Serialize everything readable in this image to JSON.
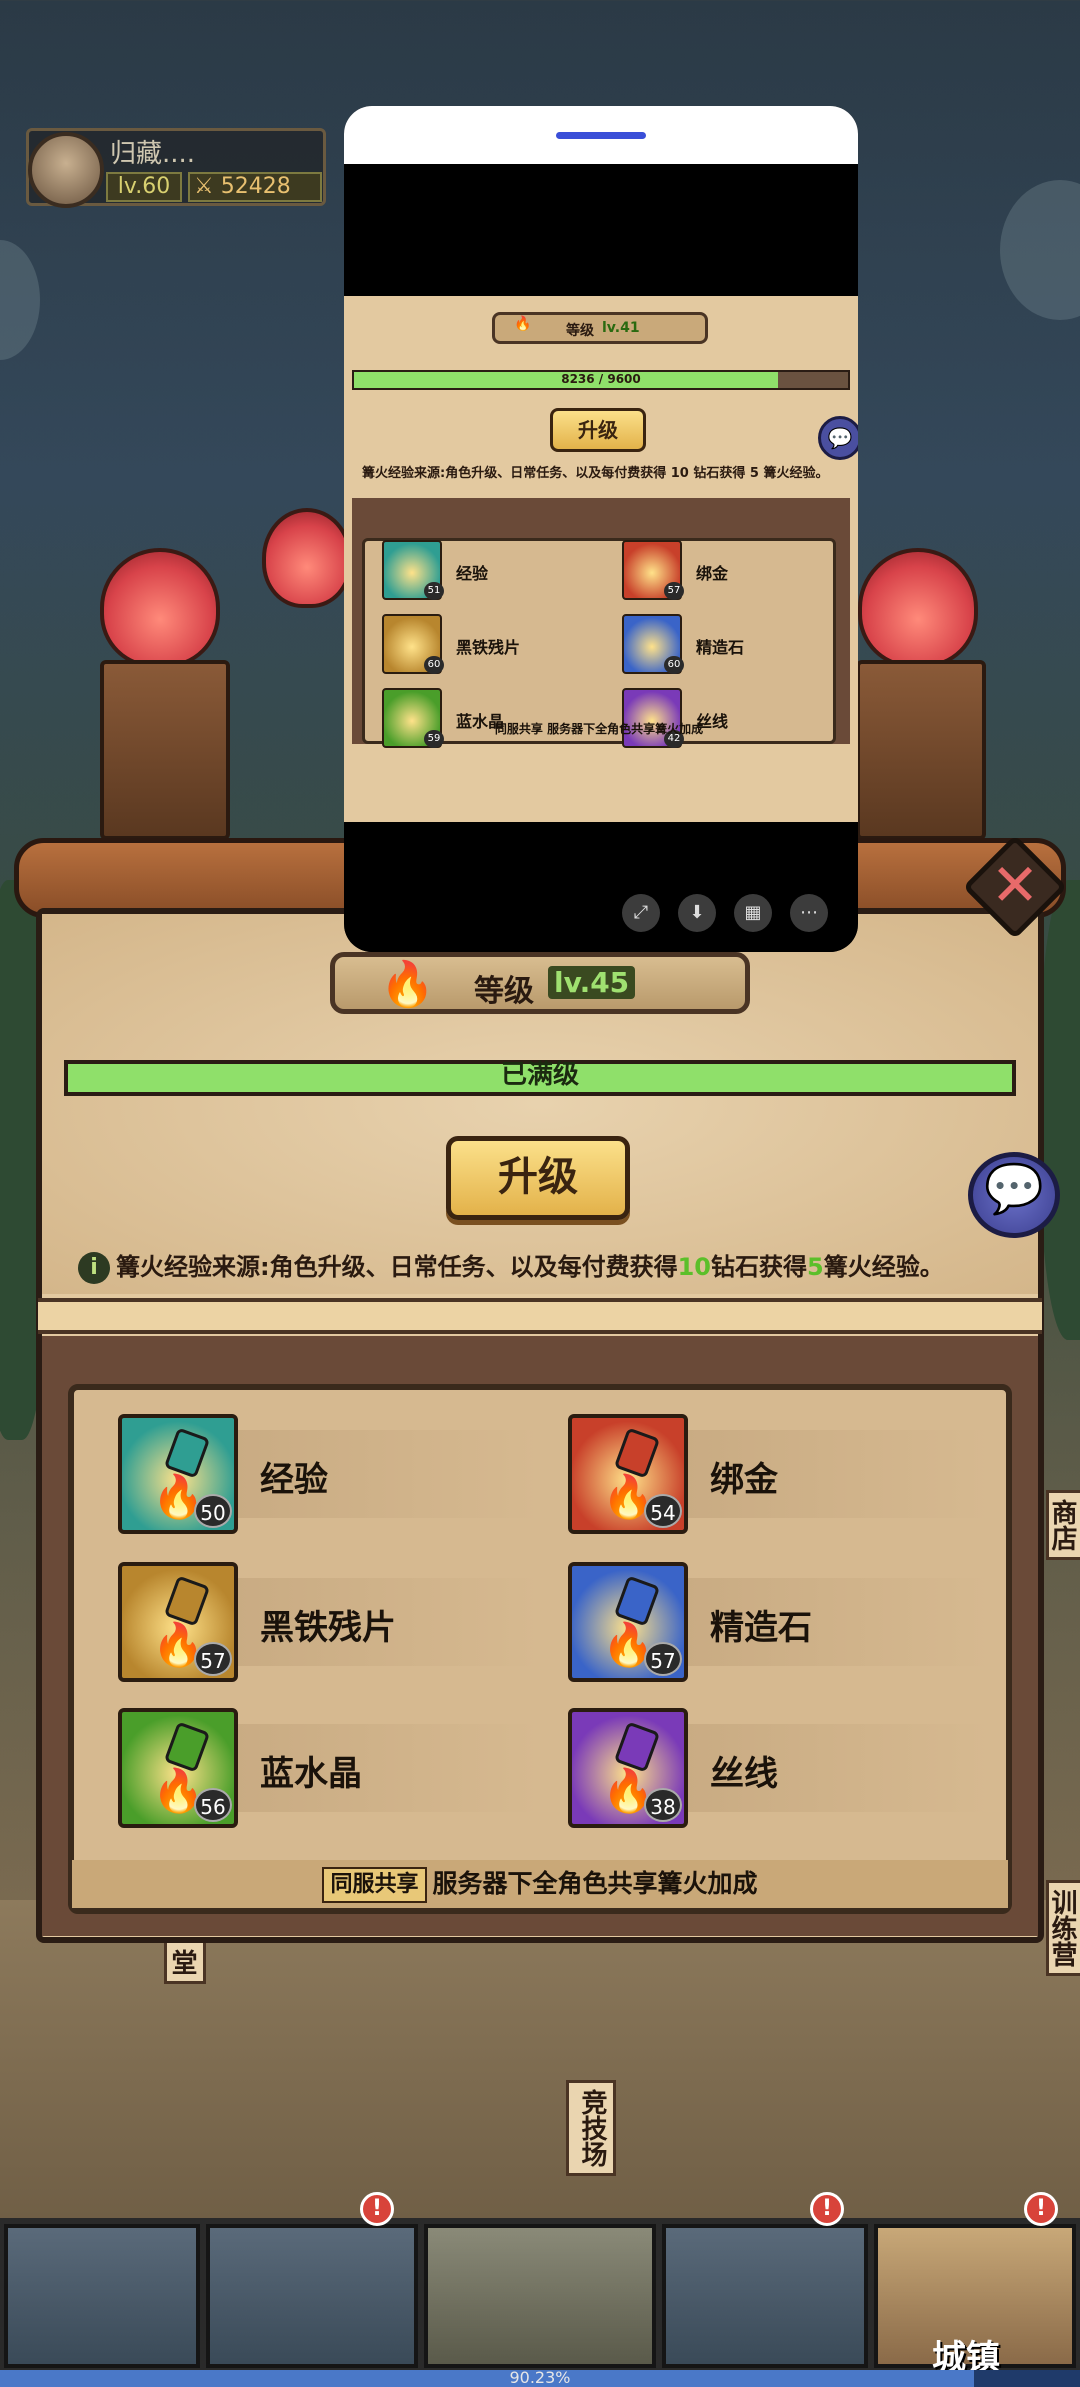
{
  "player": {
    "name": "归藏....",
    "level": "lv.60",
    "power": "52428"
  },
  "panel": {
    "level_label": "等级",
    "level_value": "lv.45",
    "bar_text": "已满级",
    "upgrade_label": "升级",
    "info_prefix": "篝火经验来源:角色升级、日常任务、以及每付费获得",
    "info_num1": "10",
    "info_mid": "钻石获得",
    "info_num2": "5",
    "info_suffix": "篝火经验。",
    "share_badge": "同服共享",
    "share_text": "服务器下全角色共享篝火加成",
    "slots": [
      {
        "name": "经验",
        "level": "50",
        "color": "#2f9e92"
      },
      {
        "name": "绑金",
        "level": "54",
        "color": "#c8402a"
      },
      {
        "name": "黑铁残片",
        "level": "57",
        "color": "#b8862e"
      },
      {
        "name": "精造石",
        "level": "57",
        "color": "#3a64c8"
      },
      {
        "name": "蓝水晶",
        "level": "56",
        "color": "#4a9e2a"
      },
      {
        "name": "丝线",
        "level": "38",
        "color": "#7a3ab8"
      }
    ]
  },
  "pip": {
    "level_label": "等级",
    "level_value": "lv.41",
    "bar_text": "8236 / 9600",
    "bar_fraction": 0.858,
    "upgrade_label": "升级",
    "info_text": "篝火经验来源:角色升级、日常任务、以及每付费获得 10 钻石获得 5 篝火经验。",
    "share_text": "同服共享 服务器下全角色共享篝火加成",
    "slots": [
      {
        "name": "经验",
        "level": "51",
        "color": "#2f9e92"
      },
      {
        "name": "绑金",
        "level": "57",
        "color": "#c8402a"
      },
      {
        "name": "黑铁残片",
        "level": "60",
        "color": "#b8862e"
      },
      {
        "name": "精造石",
        "level": "60",
        "color": "#3a64c8"
      },
      {
        "name": "蓝水晶",
        "level": "59",
        "color": "#4a9e2a"
      },
      {
        "name": "丝线",
        "level": "42",
        "color": "#7a3ab8"
      }
    ],
    "tools": [
      "⤢",
      "⬇",
      "▦",
      "⋯"
    ]
  },
  "side_tags": {
    "left": "堂",
    "right_top": "商店",
    "right_mid": "训练营",
    "arena": "竞技场"
  },
  "nav": {
    "city_label": "城镇",
    "progress_text": "90.23%",
    "progress_fraction": 0.9023
  }
}
